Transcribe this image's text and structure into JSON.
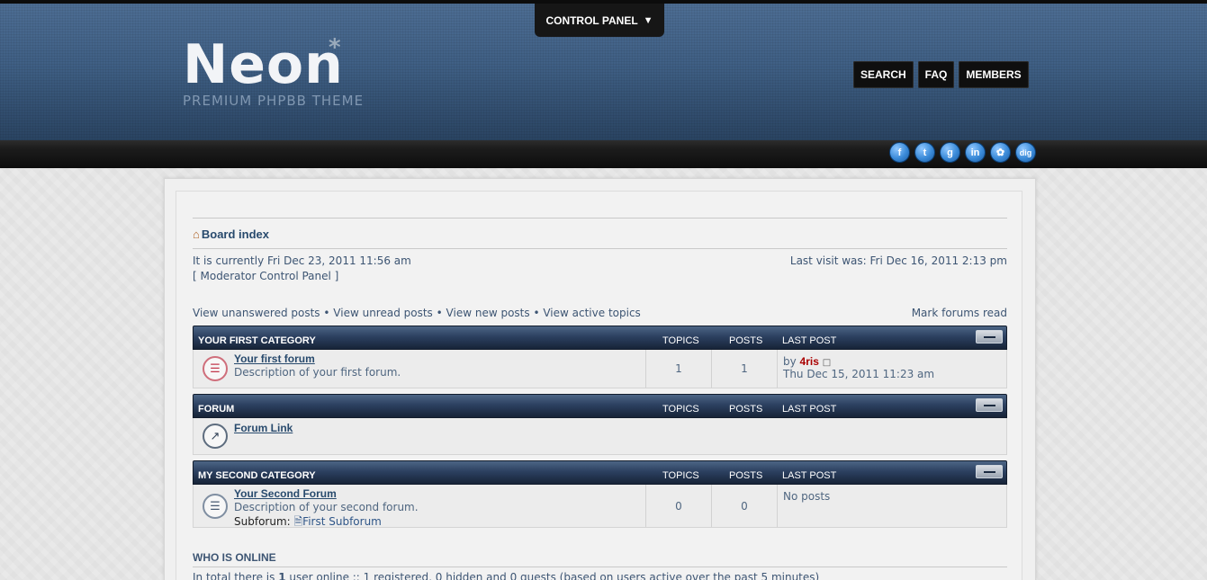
{
  "header": {
    "control_panel_label": "CONTROL PANEL",
    "control_panel_arrow": "▼",
    "logo_text": "Neon",
    "logo_star": "*",
    "logo_subtitle": "PREMIUM PHPBB THEME",
    "nav": [
      {
        "label": "SEARCH"
      },
      {
        "label": "FAQ"
      },
      {
        "label": "MEMBERS"
      }
    ],
    "social": [
      {
        "icon": "facebook-icon",
        "glyph": "f"
      },
      {
        "icon": "twitter-icon",
        "glyph": "t"
      },
      {
        "icon": "google-icon",
        "glyph": "g"
      },
      {
        "icon": "linkedin-icon",
        "glyph": "in"
      },
      {
        "icon": "myspace-icon",
        "glyph": "✿"
      },
      {
        "icon": "digg-icon",
        "glyph": "dig"
      }
    ]
  },
  "breadcrumb": {
    "label": "Board index"
  },
  "status": {
    "current_time": "It is currently Fri Dec 23, 2011 11:56 am",
    "last_visit": "Last visit was: Fri Dec 16, 2011 2:13 pm",
    "mcp_link": "[ Moderator Control Panel ]"
  },
  "quick_links": {
    "unanswered": "View unanswered posts",
    "unread": "View unread posts",
    "new_posts": "View new posts",
    "active": "View active topics",
    "separator": "•",
    "mark_read": "Mark forums read"
  },
  "columns": {
    "topics": "TOPICS",
    "posts": "POSTS",
    "last_post": "LAST POST"
  },
  "categories": [
    {
      "name": "YOUR FIRST CATEGORY",
      "forum": {
        "title": "Your first forum",
        "description": "Description of your first forum.",
        "topics": "1",
        "posts": "1",
        "last_by": "by",
        "last_user": "4ris",
        "last_time": "Thu Dec 15, 2011 11:23 am"
      }
    },
    {
      "name": "FORUM",
      "forum": {
        "title": "Forum Link"
      }
    },
    {
      "name": "MY SECOND CATEGORY",
      "forum": {
        "title": "Your Second Forum",
        "description": "Description of your second forum.",
        "subforum_label": "Subforum:",
        "subforum": "First Subforum",
        "topics": "0",
        "posts": "0",
        "last_post": "No posts"
      }
    }
  ],
  "online": {
    "title": "WHO IS ONLINE",
    "text_prefix": "In total there is ",
    "count": "1",
    "text_suffix": " user online :: 1 registered, 0 hidden and 0 guests (based on users active over the past 5 minutes)"
  },
  "colors": {
    "header_blue": "#3f5f84",
    "link_blue": "#284a6d",
    "user_red": "#aa0000"
  }
}
